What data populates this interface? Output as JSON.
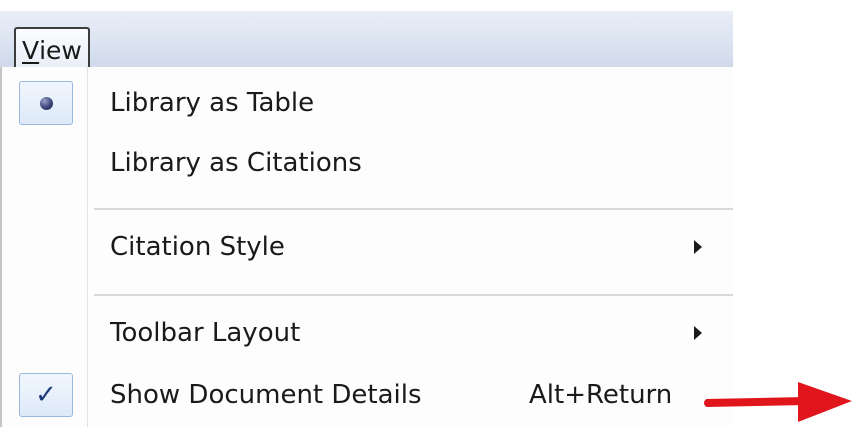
{
  "menubar": {
    "view_menu": {
      "accelerator": "V",
      "rest": "iew"
    }
  },
  "dropdown": {
    "items": [
      {
        "label": "Library as Table",
        "marker": "radio-dot",
        "selected": true
      },
      {
        "label": "Library as Citations",
        "marker": "none",
        "selected": false
      },
      {
        "label": "Citation Style",
        "submenu": true
      },
      {
        "label": "Toolbar Layout",
        "submenu": true
      },
      {
        "label": "Show Document Details",
        "shortcut": "Alt+Return",
        "marker": "check-icon",
        "checked": true
      }
    ]
  },
  "annotation": {
    "arrow_color": "#e0161c",
    "arrow_direction": "right"
  },
  "colors": {
    "menubar_bg": "#dde5f2",
    "menu_bg": "#fdfdfd",
    "check_box_border": "#9ab7dd",
    "check_color": "#1d3a7a"
  }
}
